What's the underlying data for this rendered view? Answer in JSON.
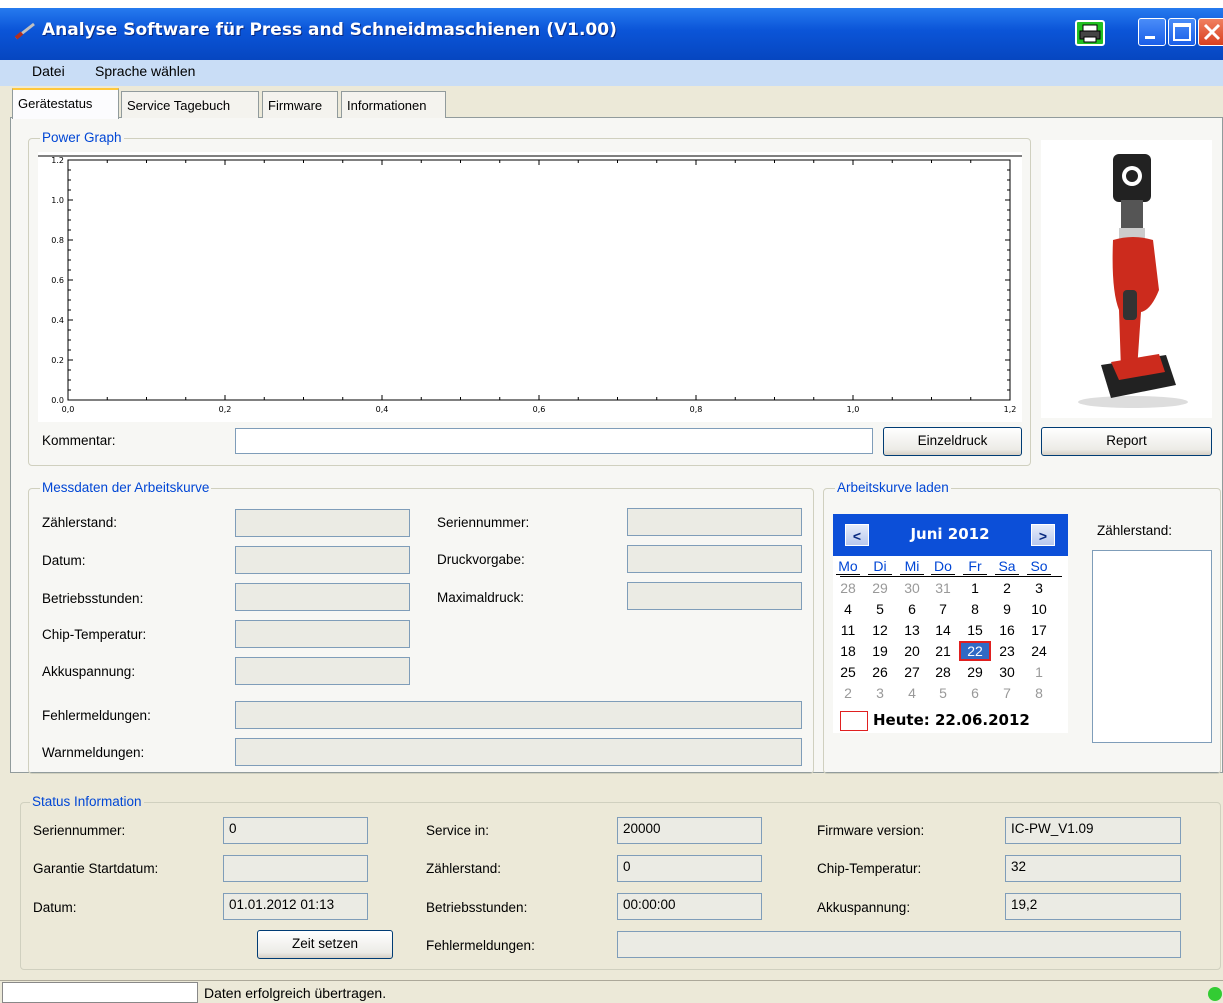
{
  "window": {
    "title": "Analyse Software für Press and Schneidmaschienen (V1.00)"
  },
  "menu": [
    "Datei",
    "Sprache wählen"
  ],
  "tabs": [
    "Gerätestatus",
    "Service Tagebuch",
    "Firmware",
    "Informationen"
  ],
  "power_graph": {
    "group_title": "Power Graph",
    "comment_label": "Kommentar:",
    "comment_value": "",
    "print_button": "Einzeldruck",
    "report_button": "Report"
  },
  "chart_data": {
    "type": "line",
    "title": "",
    "xlabel": "",
    "ylabel": "",
    "xlim": [
      0,
      1.2
    ],
    "ylim": [
      0,
      1.2
    ],
    "x_ticks": [
      "0,0",
      "0,2",
      "0,4",
      "0,6",
      "0,8",
      "1,0",
      "1,2"
    ],
    "y_ticks": [
      "0.0",
      "0.2",
      "0.4",
      "0.6",
      "0.8",
      "1.0",
      "1.2"
    ],
    "series": []
  },
  "messdaten": {
    "group_title": "Messdaten der Arbeitskurve",
    "left_labels": [
      "Zählerstand:",
      "Datum:",
      "Betriebsstunden:",
      "Chip-Temperatur:",
      "Akkuspannung:"
    ],
    "right_labels": [
      "Seriennummer:",
      "Druckvorgabe:",
      "Maximaldruck:"
    ],
    "fehler_label": "Fehlermeldungen:",
    "warn_label": "Warnmeldungen:"
  },
  "arbeitskurve": {
    "group_title": "Arbeitskurve laden",
    "counter_label": "Zählerstand:",
    "calendar": {
      "month": "Juni 2012",
      "prev": "<",
      "next": ">",
      "weekdays": [
        "Mo",
        "Di",
        "Mi",
        "Do",
        "Fr",
        "Sa",
        "So"
      ],
      "weeks": [
        [
          "28",
          "29",
          "30",
          "31",
          "1",
          "2",
          "3"
        ],
        [
          "4",
          "5",
          "6",
          "7",
          "8",
          "9",
          "10"
        ],
        [
          "11",
          "12",
          "13",
          "14",
          "15",
          "16",
          "17"
        ],
        [
          "18",
          "19",
          "20",
          "21",
          "22",
          "23",
          "24"
        ],
        [
          "25",
          "26",
          "27",
          "28",
          "29",
          "30",
          "1"
        ],
        [
          "2",
          "3",
          "4",
          "5",
          "6",
          "7",
          "8"
        ]
      ],
      "selected": "22",
      "today": "Heute: 22.06.2012"
    }
  },
  "status": {
    "group_title": "Status Information",
    "col1": [
      {
        "label": "Seriennummer:",
        "value": "0"
      },
      {
        "label": "Garantie Startdatum:",
        "value": ""
      },
      {
        "label": "Datum:",
        "value": "01.01.2012 01:13"
      }
    ],
    "col2": [
      {
        "label": "Service in:",
        "value": "20000"
      },
      {
        "label": "Zählerstand:",
        "value": "0"
      },
      {
        "label": "Betriebsstunden:",
        "value": "00:00:00"
      }
    ],
    "col3": [
      {
        "label": "Firmware version:",
        "value": "IC-PW_V1.09"
      },
      {
        "label": "Chip-Temperatur:",
        "value": "32"
      },
      {
        "label": "Akkuspannung:",
        "value": "19,2"
      }
    ],
    "fehler_label": "Fehlermeldungen:",
    "fehler_value": "",
    "time_button": "Zeit setzen"
  },
  "statusbar": {
    "message": "Daten erfolgreich übertragen."
  },
  "colors": {
    "titlebar": "#0b55d8",
    "group_title": "#0046d5",
    "selected_day_border": "#e02020",
    "status_led": "#33cc33"
  }
}
